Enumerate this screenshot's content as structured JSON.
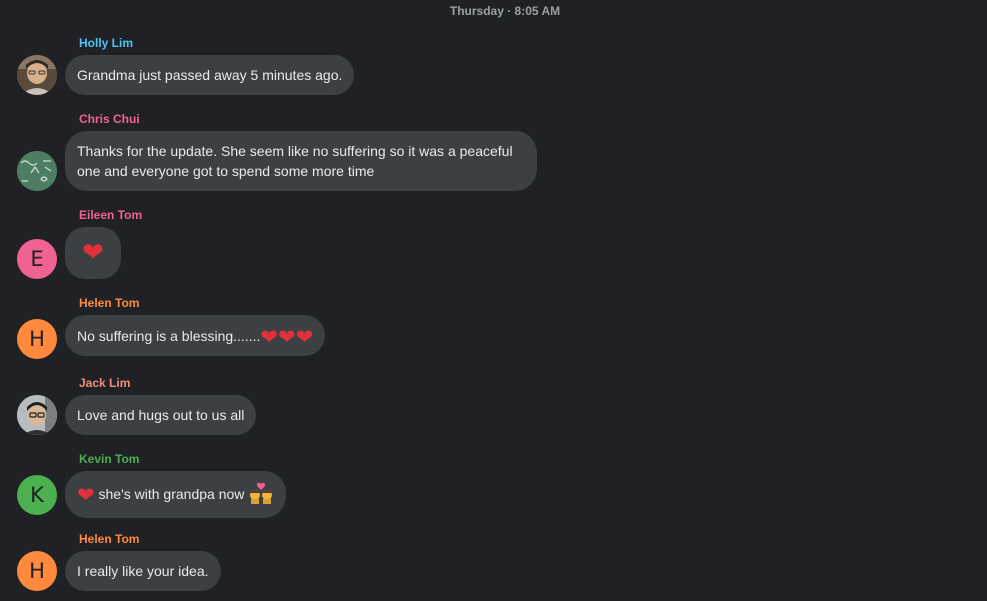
{
  "header": {
    "timestamp": "Thursday · 8:05 AM"
  },
  "colors": {
    "background": "#202124",
    "bubble": "#3c4043",
    "holly_name": "#4fc3f7",
    "chris_name": "#f06292",
    "eileen_name": "#f06292",
    "helen_name": "#ff8a3d",
    "jack_name": "#f28b82",
    "kevin_name": "#4caf50"
  },
  "messages": [
    {
      "sender": "Holly Lim",
      "avatar": "photo-avatar",
      "text": "Grandma just passed away 5 minutes ago."
    },
    {
      "sender": "Chris Chui",
      "avatar": "chalkboard-avatar",
      "text": "Thanks for the update. She seem like no suffering so it was a peaceful one and everyone got to spend some more time"
    },
    {
      "sender": "Eileen Tom",
      "avatar_letter": "E",
      "text": "❤"
    },
    {
      "sender": "Helen Tom",
      "avatar_letter": "H",
      "text": "No suffering is a blessing.......",
      "hearts": "❤❤❤"
    },
    {
      "sender": "Jack Lim",
      "avatar": "photo-avatar",
      "text": "Love and hugs out to us all"
    },
    {
      "sender": "Kevin Tom",
      "avatar_letter": "K",
      "heart": "❤",
      "text": " she's with grandpa now",
      "emoji": "kiss-emoji"
    },
    {
      "sender": "Helen Tom",
      "avatar_letter": "H",
      "text": "I really like your idea."
    }
  ]
}
